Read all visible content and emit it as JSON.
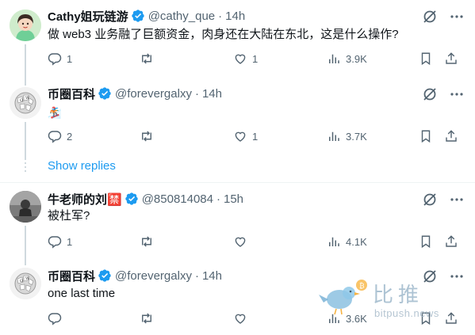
{
  "tweets": [
    {
      "name": "Cathy姐玩链游",
      "handle": "@cathy_que",
      "time": "14h",
      "text": "做 web3 业务融了巨额资金，肉身还在大陆在东北，这是什么操作?",
      "replies": "1",
      "retweets": "",
      "likes": "1",
      "views": "3.9K"
    },
    {
      "name": "币圈百科",
      "handle": "@forevergalxy",
      "time": "14h",
      "text": "🏂",
      "replies": "2",
      "retweets": "",
      "likes": "1",
      "views": "3.7K"
    },
    {
      "name": "牛老师的刘🈲",
      "handle": "@850814084",
      "time": "15h",
      "text": "被杜军?",
      "replies": "1",
      "retweets": "",
      "likes": "",
      "views": "4.1K"
    },
    {
      "name": "币圈百科",
      "handle": "@forevergalxy",
      "time": "14h",
      "text": "one last time",
      "replies": "",
      "retweets": "",
      "likes": "",
      "views": "3.6K"
    }
  ],
  "show_replies": "Show replies",
  "separator": "·",
  "watermark": {
    "main": "比推",
    "sub": "bitpush.news"
  },
  "colors": {
    "accent": "#1d9bf0",
    "muted": "#536471",
    "line": "#cfd9de"
  }
}
